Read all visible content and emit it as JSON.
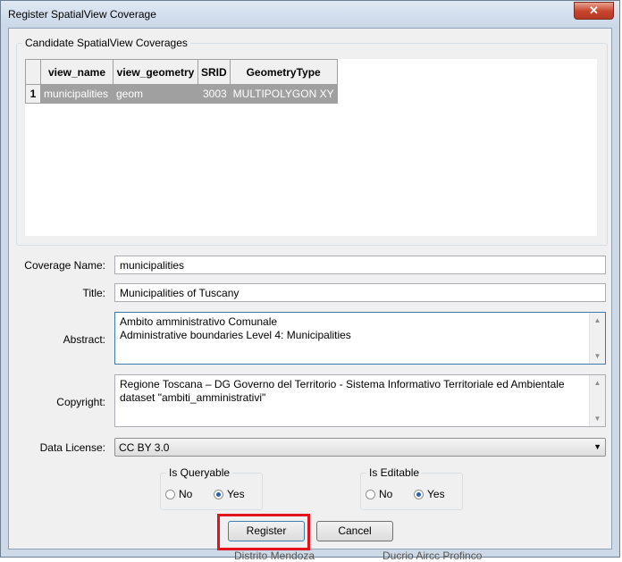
{
  "window": {
    "title": "Register SpatialView Coverage",
    "close_glyph": "✕"
  },
  "candidates": {
    "legend": "Candidate SpatialView Coverages",
    "columns": [
      "view_name",
      "view_geometry",
      "SRID",
      "GeometryType"
    ],
    "rows": [
      {
        "num": "1",
        "view_name": "municipalities",
        "view_geometry": "geom",
        "srid": "3003",
        "geometry_type": "MULTIPOLYGON XY"
      }
    ]
  },
  "form": {
    "coverage_name_label": "Coverage Name:",
    "coverage_name_value": "municipalities",
    "title_label": "Title:",
    "title_value": "Municipalities of Tuscany",
    "abstract_label": "Abstract:",
    "abstract_line1": "Ambito amministrativo Comunale",
    "abstract_line2": "Administrative boundaries Level 4: Municipalities",
    "copyright_label": "Copyright:",
    "copyright_line1": "Regione Toscana – DG Governo del Territorio - Sistema Informativo Territoriale ed Ambientale",
    "copyright_line2": "dataset \"ambiti_amministrativi\"",
    "license_label": "Data License:",
    "license_value": "CC BY 3.0"
  },
  "queryable": {
    "legend": "Is Queryable",
    "no": "No",
    "yes": "Yes",
    "selected": "Yes"
  },
  "editable": {
    "legend": "Is Editable",
    "no": "No",
    "yes": "Yes",
    "selected": "Yes"
  },
  "buttons": {
    "register": "Register",
    "cancel": "Cancel"
  },
  "background": {
    "left_text": "Distrito Mendoza",
    "right_text": "Ducrio Aircc Profinco"
  },
  "colors": {
    "highlight": "#e2131c",
    "selected_row": "#a0a0a0",
    "radio_dot": "#2a5fa8"
  },
  "icons": {
    "scroll_up": "▲",
    "scroll_down": "▼",
    "combo_arrow": "▼"
  }
}
